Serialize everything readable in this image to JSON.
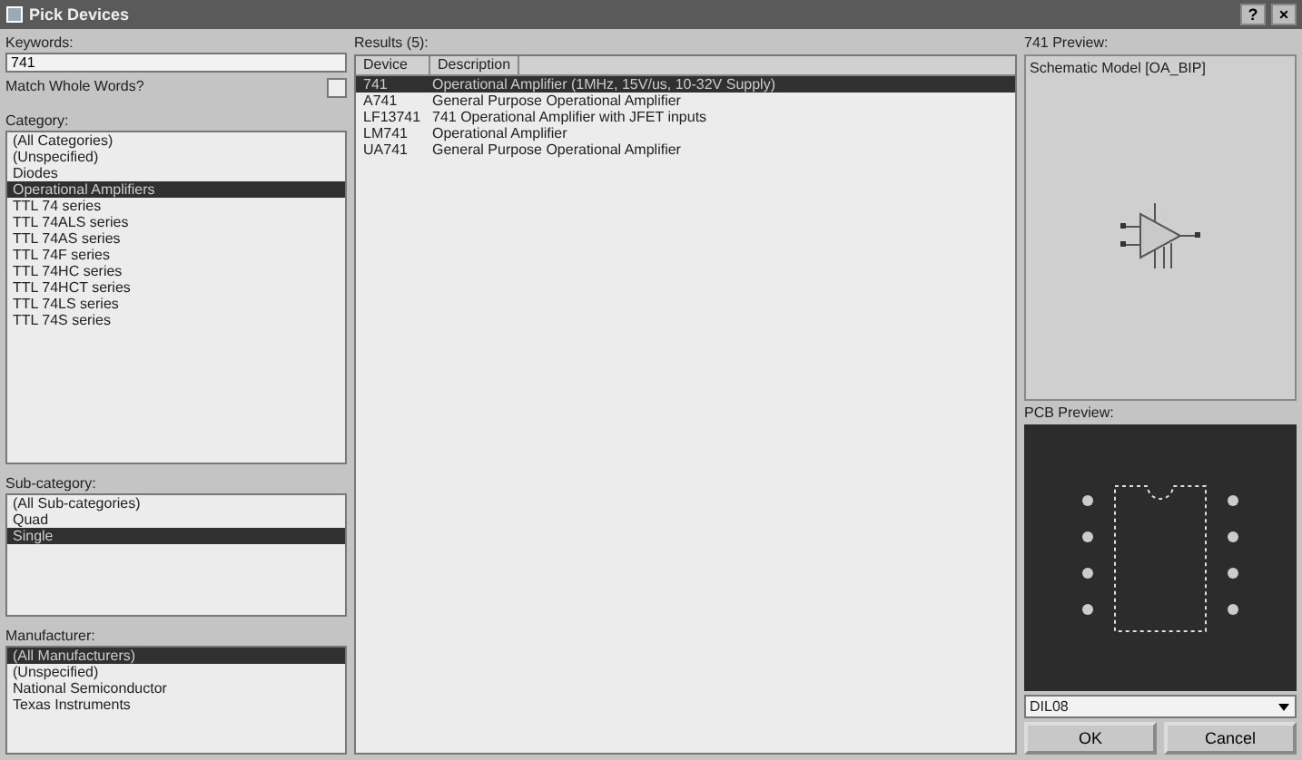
{
  "window": {
    "title": "Pick Devices",
    "buttons": [
      "?",
      "×"
    ]
  },
  "keywords": {
    "label": "Keywords:",
    "value": "741"
  },
  "match_whole_words": {
    "label": "Match Whole Words?",
    "checked": false
  },
  "category": {
    "label": "Category:",
    "items": [
      {
        "label": "(All Categories)",
        "selected": false
      },
      {
        "label": "(Unspecified)",
        "selected": false
      },
      {
        "label": "Diodes",
        "selected": false
      },
      {
        "label": "Operational Amplifiers",
        "selected": true
      },
      {
        "label": "TTL 74 series",
        "selected": false
      },
      {
        "label": "TTL 74ALS series",
        "selected": false
      },
      {
        "label": "TTL 74AS series",
        "selected": false
      },
      {
        "label": "TTL 74F series",
        "selected": false
      },
      {
        "label": "TTL 74HC series",
        "selected": false
      },
      {
        "label": "TTL 74HCT series",
        "selected": false
      },
      {
        "label": "TTL 74LS series",
        "selected": false
      },
      {
        "label": "TTL 74S series",
        "selected": false
      }
    ]
  },
  "sub_category": {
    "label": "Sub-category:",
    "items": [
      {
        "label": "(All Sub-categories)",
        "selected": false
      },
      {
        "label": "Quad",
        "selected": false
      },
      {
        "label": "Single",
        "selected": true
      }
    ]
  },
  "manufacturer": {
    "label": "Manufacturer:",
    "items": [
      {
        "label": "(All Manufacturers)",
        "selected": true
      },
      {
        "label": "(Unspecified)",
        "selected": false
      },
      {
        "label": "National Semiconductor",
        "selected": false
      },
      {
        "label": "Texas Instruments",
        "selected": false
      }
    ]
  },
  "results": {
    "label": "Results (5):",
    "columns": [
      "Device",
      "Description"
    ],
    "rows": [
      {
        "device": "741",
        "description": "Operational Amplifier (1MHz, 15V/us, 10-32V Supply)",
        "selected": true
      },
      {
        "device": "A741",
        "description": "General Purpose Operational Amplifier",
        "selected": false
      },
      {
        "device": "LF13741",
        "description": "741 Operational Amplifier with JFET inputs",
        "selected": false
      },
      {
        "device": "LM741",
        "description": "Operational Amplifier",
        "selected": false
      },
      {
        "device": "UA741",
        "description": "General Purpose Operational Amplifier",
        "selected": false
      }
    ]
  },
  "preview": {
    "label": "741 Preview:",
    "schematic_model": "Schematic Model [OA_BIP]",
    "pcb_label": "PCB Preview:",
    "package": "DIL08"
  },
  "buttons": [
    "OK",
    "Cancel"
  ]
}
